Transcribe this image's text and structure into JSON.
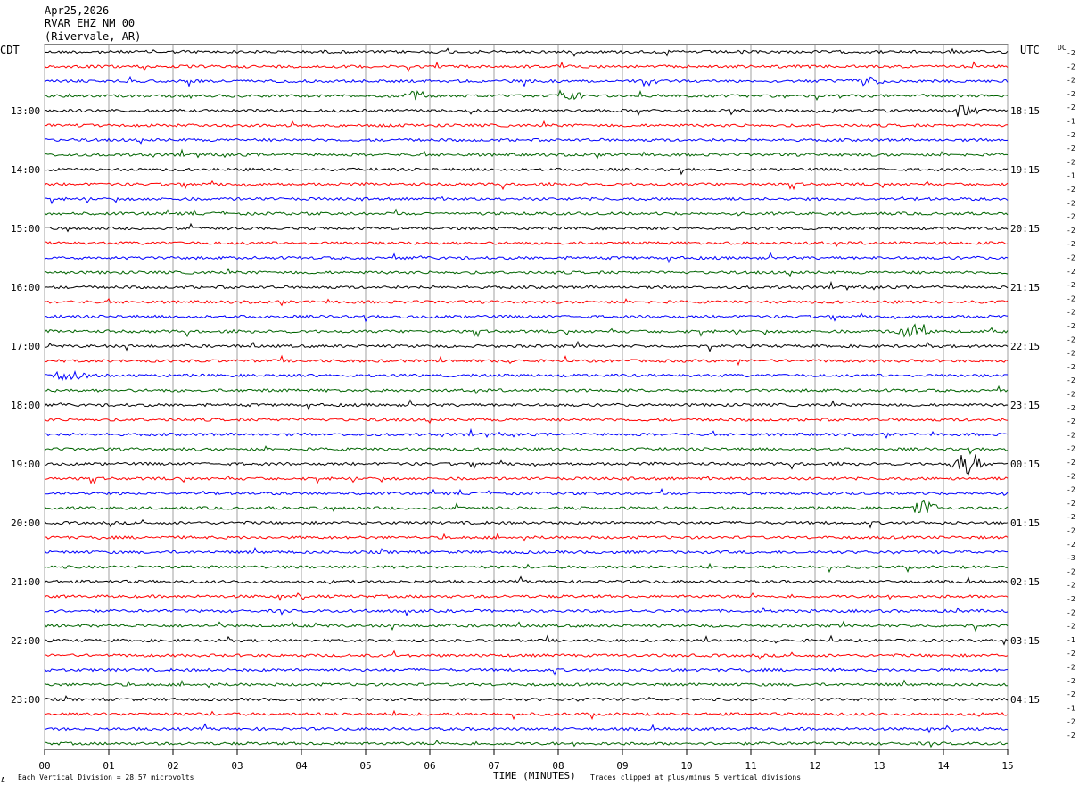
{
  "header": {
    "date": "Apr25,2026",
    "station": "RVAR EHZ NM 00",
    "location": "(Rivervale, AR)"
  },
  "left_zone_label": "CDT",
  "right_zone_label": "UTC",
  "dc_label": "DC",
  "footer": {
    "scale_note": "Each Vertical Division =   28.57 microvolts",
    "clip_note": "Traces clipped at plus/minus 5 vertical divisions",
    "corner_mark": "A"
  },
  "chart_data": {
    "type": "line",
    "title": "",
    "xlabel": "TIME (MINUTES)",
    "ylabel": "",
    "xlim": [
      0,
      15
    ],
    "x_ticks": [
      "00",
      "01",
      "02",
      "03",
      "04",
      "05",
      "06",
      "07",
      "08",
      "09",
      "10",
      "11",
      "12",
      "13",
      "14",
      "15"
    ],
    "grid": true,
    "trace_colors": [
      "#000000",
      "#ff0000",
      "#0000ff",
      "#006400"
    ],
    "trace_count": 48,
    "trace_interval_minutes": 15,
    "first_trace_start_cdt": "12:00",
    "left_hour_labels": [
      "13:00",
      "14:00",
      "15:00",
      "16:00",
      "17:00",
      "18:00",
      "19:00",
      "20:00",
      "21:00",
      "22:00",
      "23:00"
    ],
    "right_hour_labels": [
      "18:15",
      "19:15",
      "20:15",
      "21:15",
      "22:15",
      "23:15",
      "00:15",
      "01:15",
      "02:15",
      "03:15",
      "04:15"
    ],
    "dc_offsets": [
      -2,
      -2,
      -2,
      -2,
      -2,
      -1,
      -2,
      -2,
      -2,
      -1,
      -2,
      -2,
      -2,
      -2,
      -2,
      -2,
      -2,
      -2,
      -2,
      -2,
      -2,
      -2,
      -2,
      -2,
      -2,
      -2,
      -2,
      -2,
      -2,
      -2,
      -2,
      -2,
      -2,
      -2,
      -2,
      -2,
      -2,
      -3,
      -2,
      -2,
      -2,
      -2,
      -2,
      -1,
      -2,
      -2,
      -2,
      -2,
      -1,
      -2,
      -2,
      -2
    ],
    "events": [
      {
        "trace": 2,
        "minute": 12.8,
        "amplitude": 5
      },
      {
        "trace": 3,
        "minute": 5.8,
        "amplitude": 6
      },
      {
        "trace": 3,
        "minute": 8.2,
        "amplitude": 4
      },
      {
        "trace": 4,
        "minute": 14.3,
        "amplitude": 7
      },
      {
        "trace": 19,
        "minute": 13.5,
        "amplitude": 10
      },
      {
        "trace": 22,
        "minute": 0.4,
        "amplitude": 7
      },
      {
        "trace": 28,
        "minute": 14.4,
        "amplitude": 14
      },
      {
        "trace": 31,
        "minute": 13.7,
        "amplitude": 8
      }
    ]
  }
}
